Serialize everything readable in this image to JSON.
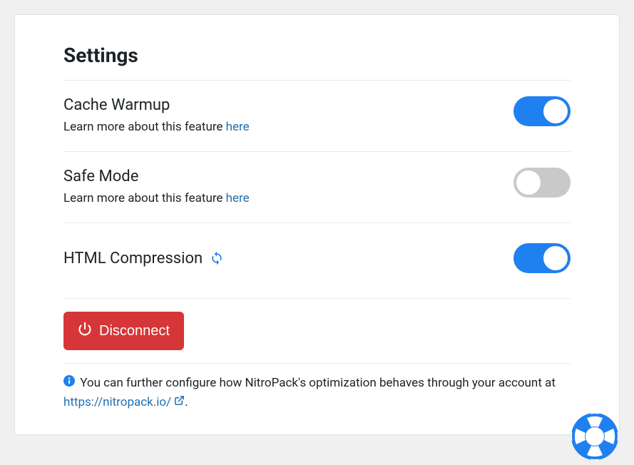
{
  "title": "Settings",
  "settings": [
    {
      "title": "Cache Warmup",
      "desc_prefix": "Learn more about this feature ",
      "link_text": "here",
      "enabled": true,
      "has_desc": true,
      "has_refresh": false
    },
    {
      "title": "Safe Mode",
      "desc_prefix": "Learn more about this feature ",
      "link_text": "here",
      "enabled": false,
      "has_desc": true,
      "has_refresh": false
    },
    {
      "title": "HTML Compression",
      "desc_prefix": "",
      "link_text": "",
      "enabled": true,
      "has_desc": false,
      "has_refresh": true
    }
  ],
  "disconnect_label": "Disconnect",
  "info_text_prefix": "You can further configure how NitroPack's optimization behaves through your account at ",
  "info_link_text": "https://nitropack.io/",
  "info_text_suffix": "."
}
